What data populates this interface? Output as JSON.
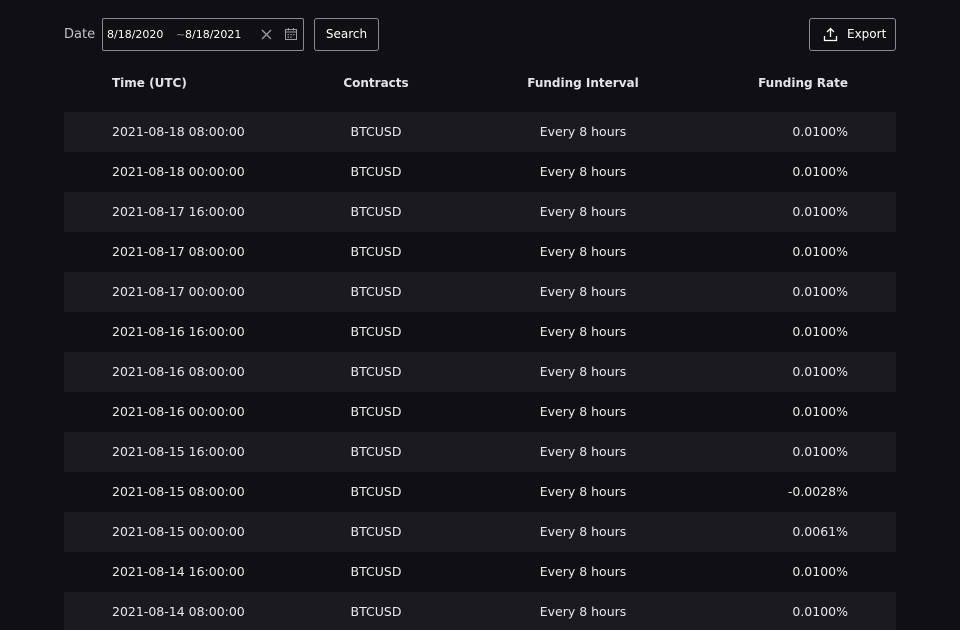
{
  "filter": {
    "date_label": "Date",
    "start_date": "8/18/2020",
    "separator": "~",
    "end_date": "8/18/2021",
    "search_label": "Search",
    "export_label": "Export"
  },
  "table": {
    "headers": {
      "time": "Time (UTC)",
      "contracts": "Contracts",
      "interval": "Funding Interval",
      "rate": "Funding Rate"
    },
    "rows": [
      {
        "time": "2021-08-18 08:00:00",
        "contract": "BTCUSD",
        "interval": "Every 8 hours",
        "rate": "0.0100%"
      },
      {
        "time": "2021-08-18 00:00:00",
        "contract": "BTCUSD",
        "interval": "Every 8 hours",
        "rate": "0.0100%"
      },
      {
        "time": "2021-08-17 16:00:00",
        "contract": "BTCUSD",
        "interval": "Every 8 hours",
        "rate": "0.0100%"
      },
      {
        "time": "2021-08-17 08:00:00",
        "contract": "BTCUSD",
        "interval": "Every 8 hours",
        "rate": "0.0100%"
      },
      {
        "time": "2021-08-17 00:00:00",
        "contract": "BTCUSD",
        "interval": "Every 8 hours",
        "rate": "0.0100%"
      },
      {
        "time": "2021-08-16 16:00:00",
        "contract": "BTCUSD",
        "interval": "Every 8 hours",
        "rate": "0.0100%"
      },
      {
        "time": "2021-08-16 08:00:00",
        "contract": "BTCUSD",
        "interval": "Every 8 hours",
        "rate": "0.0100%"
      },
      {
        "time": "2021-08-16 00:00:00",
        "contract": "BTCUSD",
        "interval": "Every 8 hours",
        "rate": "0.0100%"
      },
      {
        "time": "2021-08-15 16:00:00",
        "contract": "BTCUSD",
        "interval": "Every 8 hours",
        "rate": "0.0100%"
      },
      {
        "time": "2021-08-15 08:00:00",
        "contract": "BTCUSD",
        "interval": "Every 8 hours",
        "rate": "-0.0028%"
      },
      {
        "time": "2021-08-15 00:00:00",
        "contract": "BTCUSD",
        "interval": "Every 8 hours",
        "rate": "0.0061%"
      },
      {
        "time": "2021-08-14 16:00:00",
        "contract": "BTCUSD",
        "interval": "Every 8 hours",
        "rate": "0.0100%"
      },
      {
        "time": "2021-08-14 08:00:00",
        "contract": "BTCUSD",
        "interval": "Every 8 hours",
        "rate": "0.0100%"
      }
    ]
  },
  "icons": {
    "clear": "close-icon",
    "calendar": "calendar-icon",
    "export": "upload-icon"
  },
  "colors": {
    "background": "#101014",
    "row_alt": "#1a1a20",
    "border": "#8a8a90",
    "text": "#e9e9ec"
  }
}
